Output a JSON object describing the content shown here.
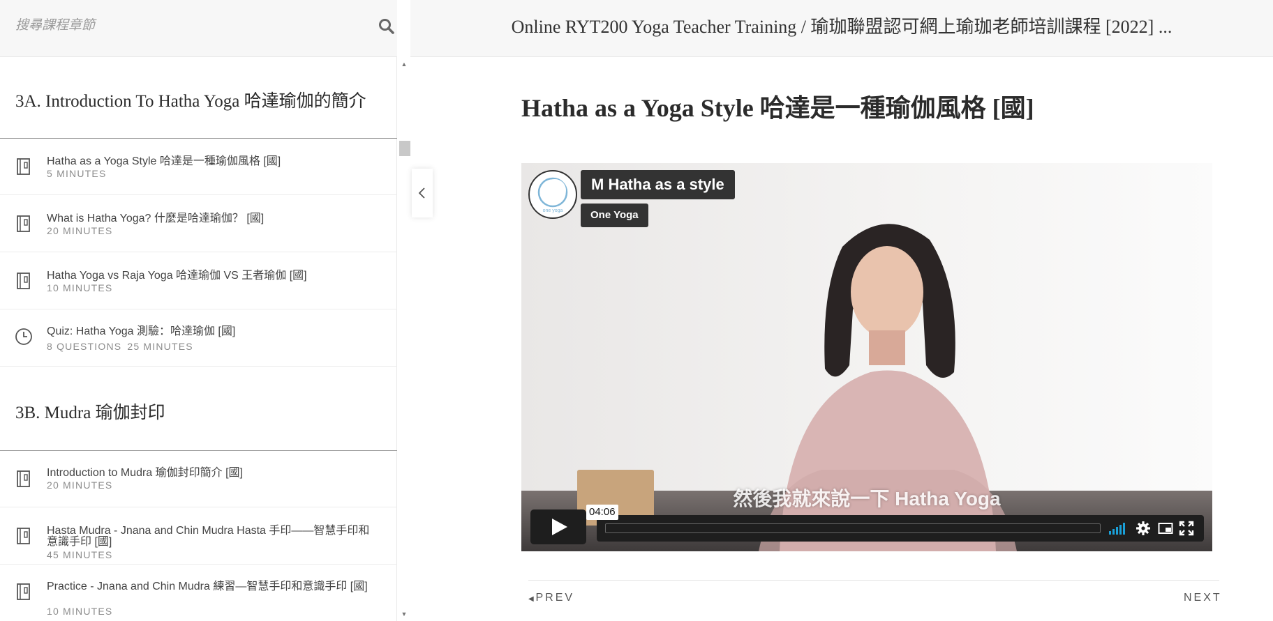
{
  "search": {
    "placeholder": "搜尋課程章節",
    "icon": "search-icon"
  },
  "course": {
    "title": "Online RYT200 Yoga Teacher Training / 瑜珈聯盟認可網上瑜珈老師培訓課程 [2022] ..."
  },
  "sections": [
    {
      "title": "3A. Introduction To Hatha Yoga 哈達瑜伽的簡介",
      "lessons": [
        {
          "title": "Hatha as a Yoga Style 哈達是一種瑜伽風格 [國]",
          "meta": [
            "5 MINUTES"
          ],
          "icon": "notebook-icon"
        },
        {
          "title": "What is Hatha Yoga? 什麼是哈達瑜伽？ [國]",
          "meta": [
            "20 MINUTES"
          ],
          "icon": "notebook-icon"
        },
        {
          "title": "Hatha Yoga vs Raja Yoga 哈達瑜伽 VS 王者瑜伽 [國]",
          "meta": [
            "10 MINUTES"
          ],
          "icon": "notebook-icon"
        },
        {
          "title": "Quiz: Hatha Yoga 測驗：哈達瑜伽 [國]",
          "meta": [
            "8 QUESTIONS",
            "25 MINUTES"
          ],
          "icon": "clock-icon"
        }
      ]
    },
    {
      "title": "3B. Mudra 瑜伽封印",
      "lessons": [
        {
          "title": "Introduction to Mudra 瑜伽封印簡介 [國]",
          "meta": [
            "20 MINUTES"
          ],
          "icon": "notebook-icon"
        },
        {
          "title": "Hasta Mudra - Jnana and Chin Mudra Hasta 手印——智慧手印和意識手印 [國]",
          "meta": [
            "45 MINUTES"
          ],
          "icon": "notebook-icon"
        },
        {
          "title": "Practice - Jnana and Chin Mudra 練習—智慧手印和意識手印 [國]",
          "meta": [
            "10 MINUTES"
          ],
          "icon": "notebook-icon"
        }
      ]
    }
  ],
  "lesson": {
    "heading": "Hatha as a Yoga Style 哈達是一種瑜伽風格 [國]"
  },
  "video": {
    "title": "M Hatha as a style",
    "byline": "One Yoga",
    "logo_text": "one yoga",
    "subtitle": "然後我就來說一下 Hatha Yoga",
    "timecode": "04:06",
    "progress": 0.0,
    "accent": "#1aa0d8"
  },
  "nav": {
    "prev": "PREV",
    "next": "NEXT"
  }
}
